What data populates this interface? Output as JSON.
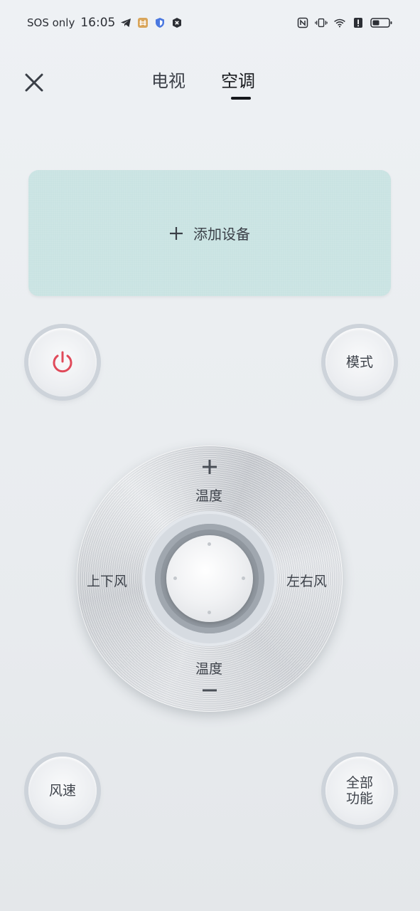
{
  "status_bar": {
    "carrier": "SOS only",
    "time": "16:05"
  },
  "tabs": [
    {
      "label": "电视",
      "active": false
    },
    {
      "label": "空调",
      "active": true
    }
  ],
  "add_device": {
    "label": "添加设备"
  },
  "buttons": {
    "power_icon": "power-icon",
    "mode": "模式",
    "fan_speed": "风速",
    "all_functions_line1": "全部",
    "all_functions_line2": "功能"
  },
  "dial": {
    "temp_up_label": "温度",
    "temp_down_label": "温度",
    "left_label": "上下风",
    "right_label": "左右风"
  },
  "colors": {
    "accent_power": "#e04a5a",
    "card_bg": "#c9e3e2",
    "active_tab": "#15171b"
  }
}
